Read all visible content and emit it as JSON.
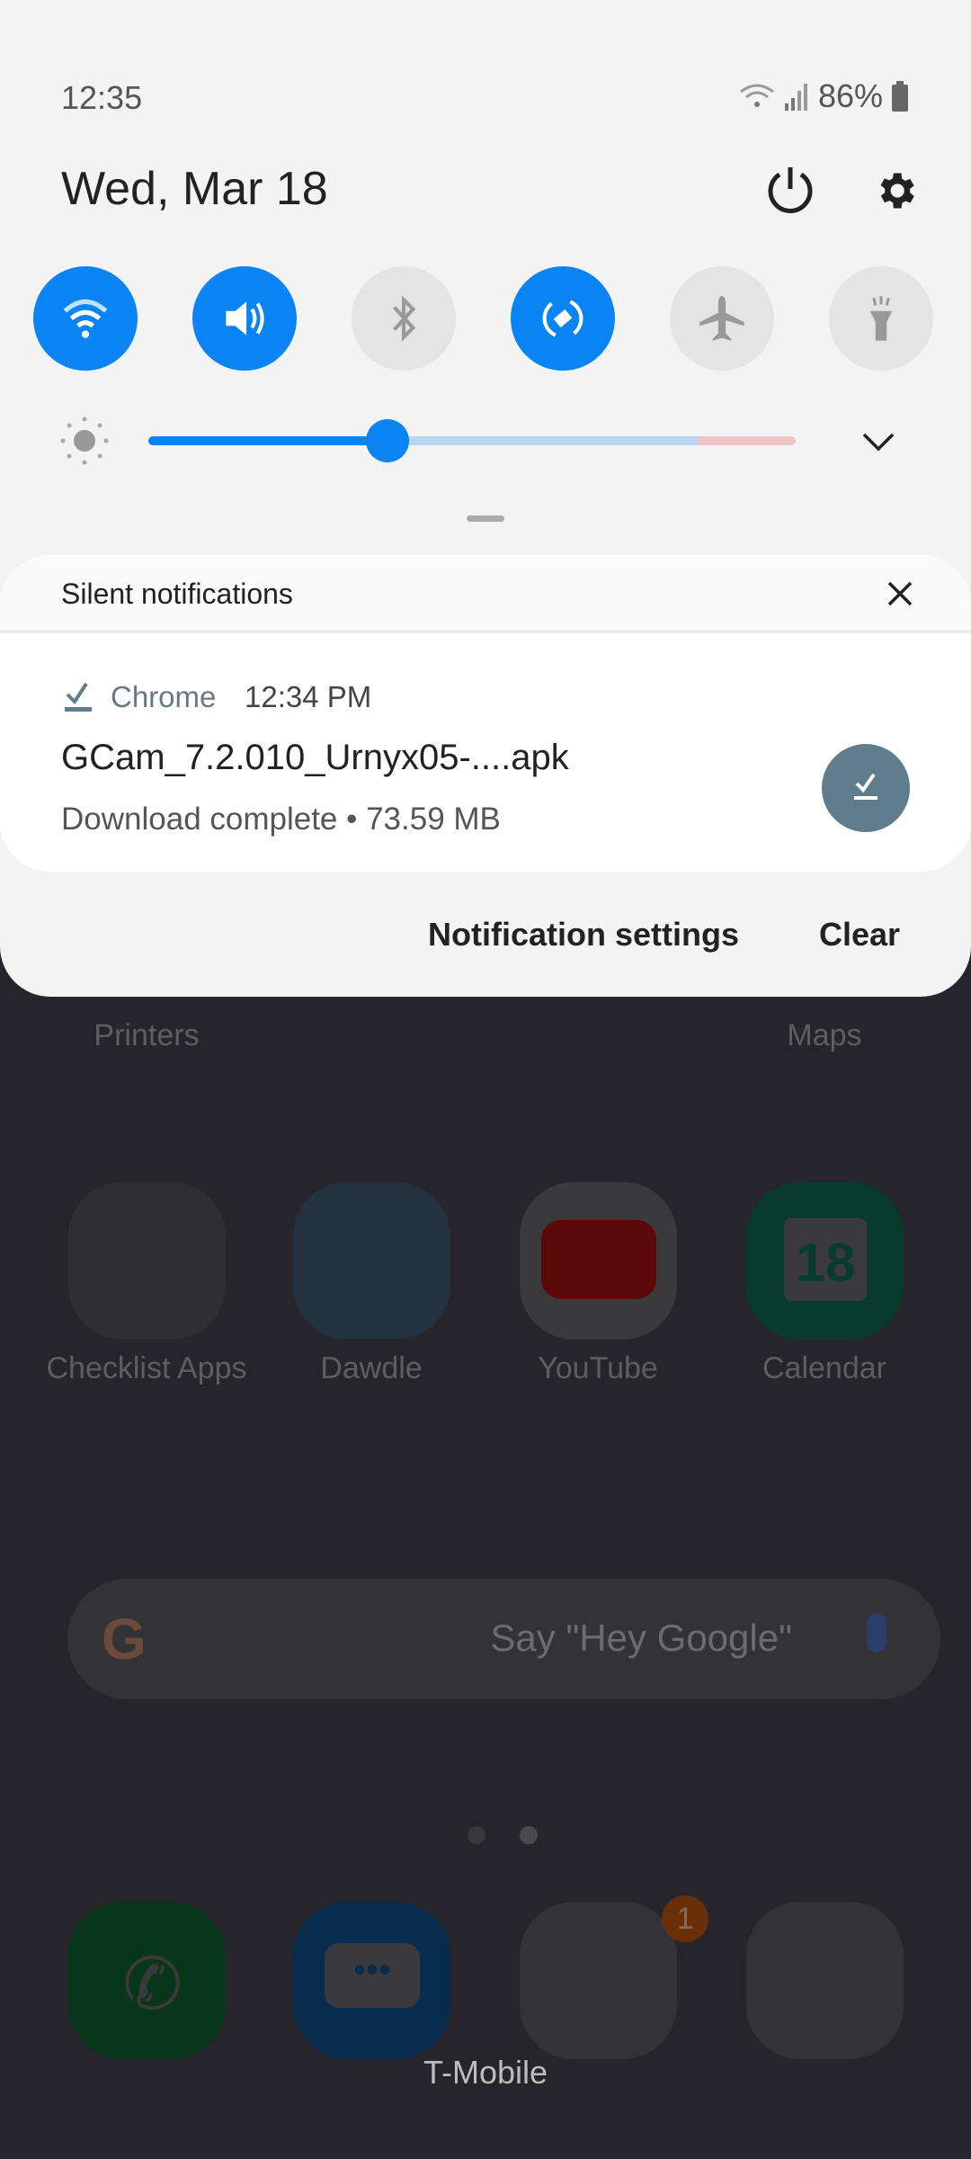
{
  "status_bar": {
    "time": "12:35",
    "battery": "86%"
  },
  "header": {
    "date": "Wed, Mar 18"
  },
  "quick_toggles": [
    {
      "name": "wifi",
      "icon": "wifi-icon",
      "on": true
    },
    {
      "name": "sound",
      "icon": "volume-icon",
      "on": true
    },
    {
      "name": "bluetooth",
      "icon": "bluetooth-icon",
      "on": false
    },
    {
      "name": "auto-rotate",
      "icon": "rotate-icon",
      "on": true
    },
    {
      "name": "airplane",
      "icon": "airplane-icon",
      "on": false
    },
    {
      "name": "flashlight",
      "icon": "flashlight-icon",
      "on": false
    }
  ],
  "brightness": {
    "level_percent": 37
  },
  "colors": {
    "accent": "#0a84f5",
    "download_icon_bg": "#5f7d8c"
  },
  "notifications": {
    "section_title": "Silent notifications",
    "items": [
      {
        "app": "Chrome",
        "time": "12:34 PM",
        "title": "GCam_7.2.010_Urnyx05-....apk",
        "text": "Download complete • 73.59 MB"
      }
    ],
    "settings_label": "Notification settings",
    "clear_label": "Clear"
  },
  "home": {
    "partial_labels": [
      "Printers",
      "Maps"
    ],
    "apps": [
      "Checklist Apps",
      "Dawdle",
      "YouTube",
      "Calendar"
    ],
    "calendar_day": "18",
    "search_placeholder": "Say \"Hey Google\"",
    "dock_badge": "1",
    "carrier": "T-Mobile"
  }
}
